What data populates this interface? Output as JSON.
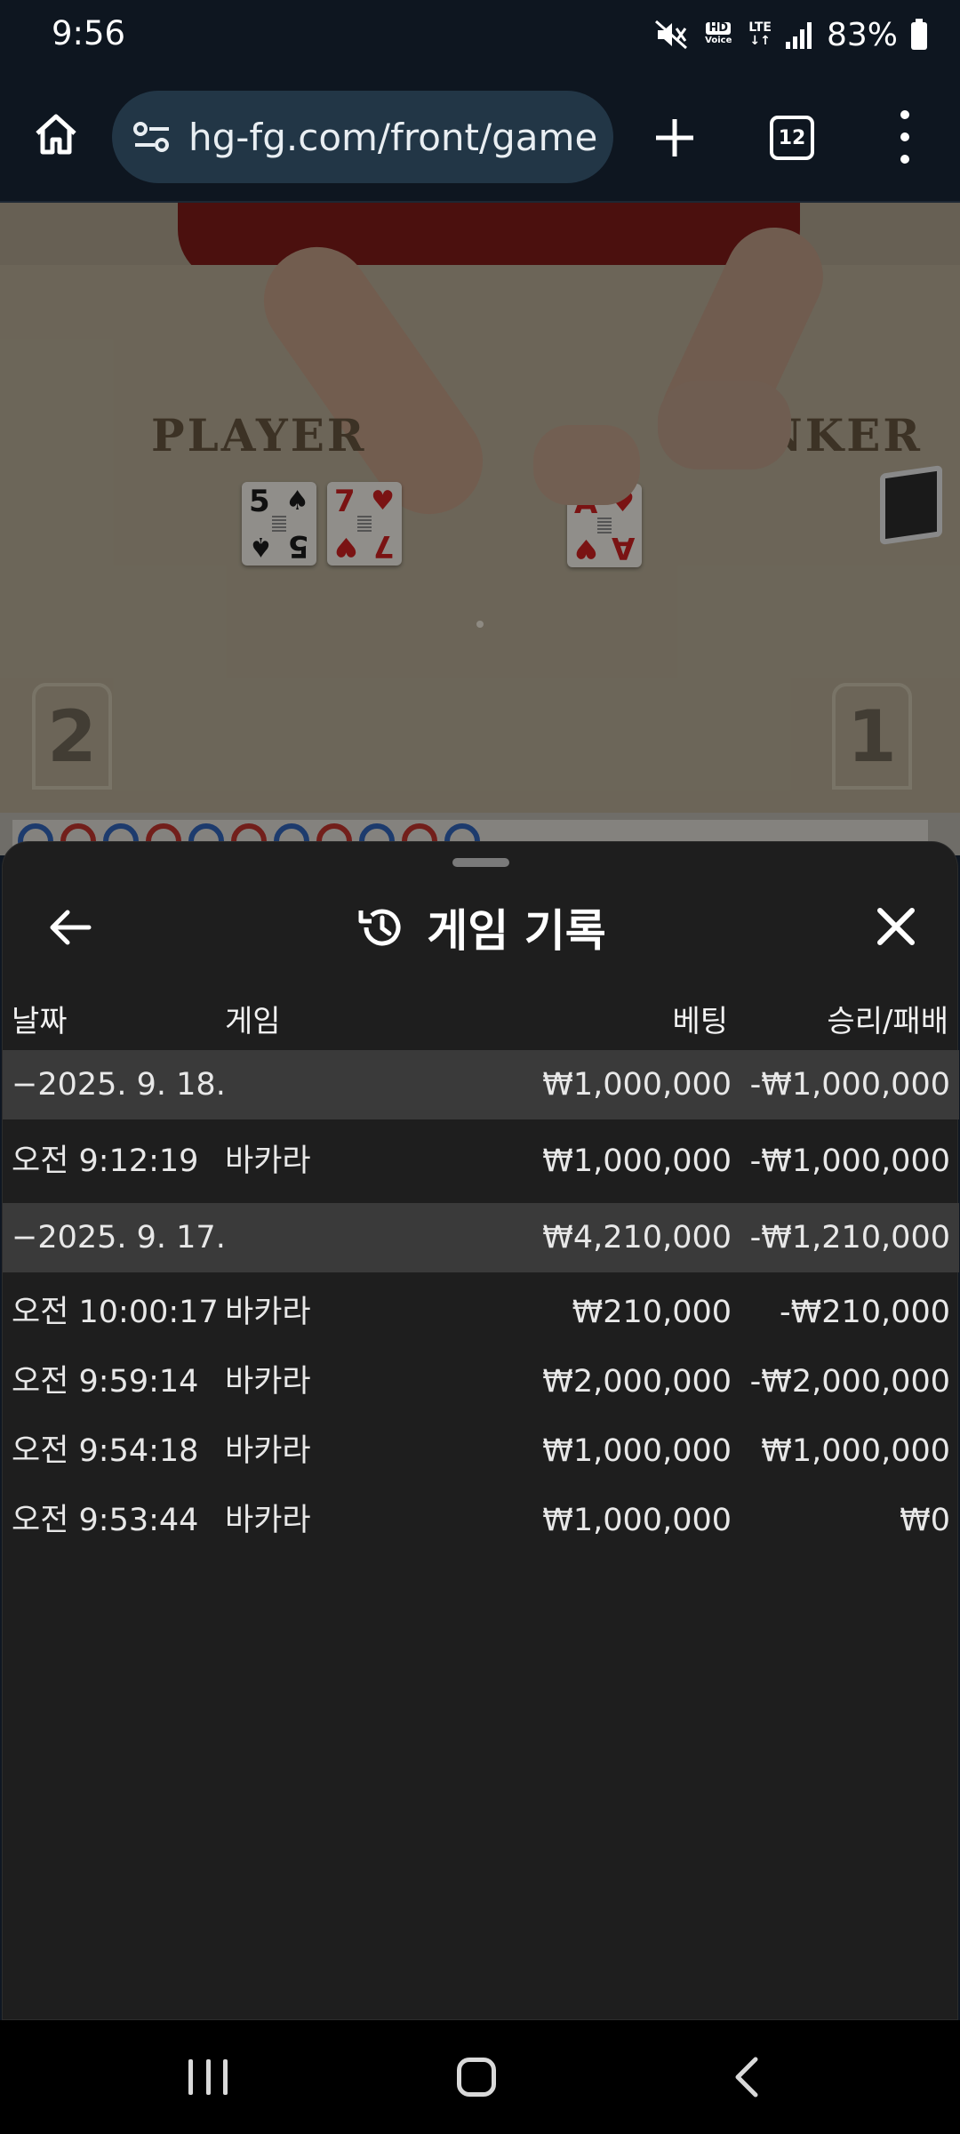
{
  "status_bar": {
    "time": "9:56",
    "hd_voice": "HD",
    "hd_voice_sub": "Voice",
    "lte": "LTE",
    "battery": "83%"
  },
  "browser": {
    "url": "hg-fg.com/front/game",
    "tab_count": "12",
    "icons": [
      "home-icon",
      "site-settings-icon",
      "plus-icon",
      "tabs-icon",
      "more-vert-icon"
    ]
  },
  "video": {
    "player_label": "PLAYER",
    "banker_label": "BANKER",
    "player_cards": [
      {
        "rank": "5",
        "suit": "♠",
        "color": "black"
      },
      {
        "rank": "7",
        "suit": "♥",
        "color": "red"
      }
    ],
    "banker_cards": [
      {
        "rank": "A",
        "suit": "♥",
        "color": "red"
      }
    ],
    "seat_left": "2",
    "seat_right": "1"
  },
  "roadmap": {
    "dots": [
      "P",
      "B",
      "P",
      "B",
      "P",
      "B",
      "P",
      "B",
      "P",
      "B",
      "P"
    ]
  },
  "sheet": {
    "title": "게임 기록",
    "columns": {
      "date": "날짜",
      "game": "게임",
      "bet": "베팅",
      "result": "승리/패배"
    },
    "rows": [
      {
        "type": "group",
        "date": "−2025. 9. 18.",
        "game": "",
        "bet": "₩1,000,000",
        "result": "-₩1,000,000"
      },
      {
        "type": "item",
        "date": "오전 9:12:19",
        "game": "바카라",
        "bet": "₩1,000,000",
        "result": "-₩1,000,000"
      },
      {
        "type": "group",
        "date": "−2025. 9. 17.",
        "game": "",
        "bet": "₩4,210,000",
        "result": "-₩1,210,000"
      },
      {
        "type": "item",
        "date": "오전 10:00:17",
        "game": "바카라",
        "bet": "₩210,000",
        "result": "-₩210,000"
      },
      {
        "type": "item",
        "date": "오전 9:59:14",
        "game": "바카라",
        "bet": "₩2,000,000",
        "result": "-₩2,000,000"
      },
      {
        "type": "item",
        "date": "오전 9:54:18",
        "game": "바카라",
        "bet": "₩1,000,000",
        "result": "₩1,000,000"
      },
      {
        "type": "item",
        "date": "오전 9:53:44",
        "game": "바카라",
        "bet": "₩1,000,000",
        "result": "₩0"
      }
    ]
  },
  "colors": {
    "sheet_bg": "#1e1e1e",
    "group_row_bg": "#3a3a3a",
    "url_pill": "#223646"
  }
}
